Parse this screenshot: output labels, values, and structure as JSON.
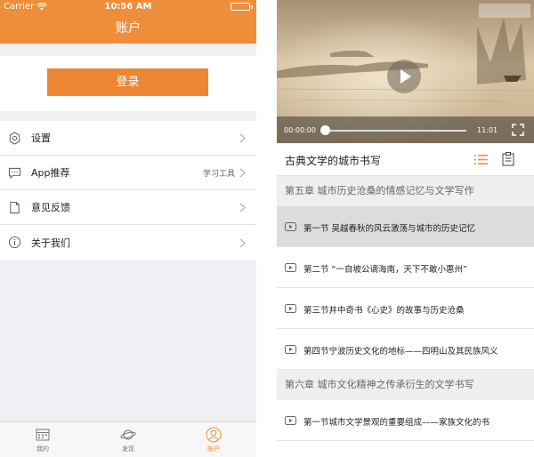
{
  "status_bar": {
    "carrier": "Carrier",
    "time": "10:56 AM"
  },
  "account": {
    "title": "账户",
    "login_label": "登录",
    "menu": [
      {
        "label": "设置",
        "note": "",
        "icon": "gear-icon"
      },
      {
        "label": "App推荐",
        "note": "学习工具",
        "icon": "message-icon"
      },
      {
        "label": "意见反馈",
        "note": "",
        "icon": "document-icon"
      },
      {
        "label": "关于我们",
        "note": "",
        "icon": "info-icon"
      }
    ]
  },
  "tabbar": {
    "tabs": [
      {
        "label": "我的",
        "icon": "calendar-icon"
      },
      {
        "label": "发现",
        "icon": "planet-icon"
      },
      {
        "label": "账户",
        "icon": "user-icon"
      }
    ],
    "active_index": 2,
    "active_color": "#ef8e3a"
  },
  "player": {
    "current_time": "00:00:00",
    "duration": "11:01",
    "progress": 0.0
  },
  "course": {
    "title": "古典文学的城市书写",
    "chapters": [
      {
        "title": "第五章  城市历史沧桑的情感记忆与文学写作",
        "lessons": [
          "第一节  吴越春秋的风云激荡与城市的历史记忆",
          "第二节  “一自坡公谪海南，天下不敢小惠州”",
          "第三节井中奇书《心史》的故事与历史沧桑",
          "第四节宁波历史文化的地标——四明山及其民族风义"
        ]
      },
      {
        "title": "第六章  城市文化精神之传承衍生的文学书写",
        "lessons": [
          "第一节城市文学景观的重要组成——家族文化的书"
        ]
      }
    ],
    "active_lesson": "第一节  吴越春秋的风云激荡与城市的历史记忆"
  },
  "colors": {
    "accent": "#ef8e3a",
    "button": "#ec8632"
  }
}
